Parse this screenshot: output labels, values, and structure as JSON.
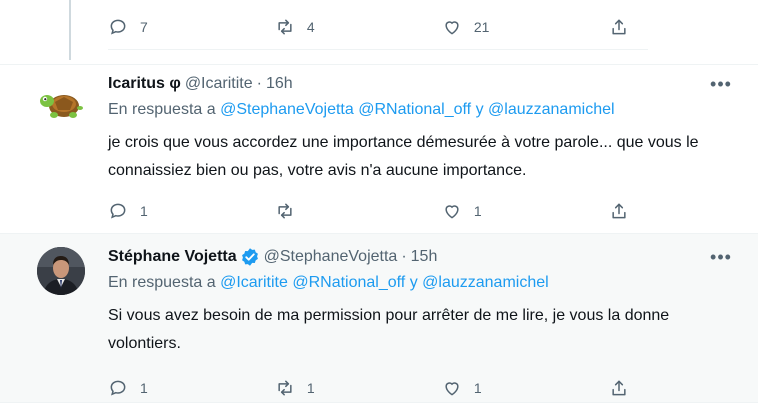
{
  "top_tweet": {
    "actions": {
      "reply_count": "7",
      "retweet_count": "4",
      "like_count": "21",
      "share_count": ""
    }
  },
  "tweets": [
    {
      "name": "Icaritus φ",
      "handle": "@Icaritite",
      "dot": "·",
      "time": "16h",
      "reply_prefix": "En respuesta a",
      "mentions": [
        "@StephaneVojetta",
        "@RNational_off",
        "@lauzzanamichel"
      ],
      "connector": "y",
      "text": "je crois que vous accordez une importance démesurée à votre parole... que vous le connaissiez bien ou pas, votre avis n'a aucune importance.",
      "actions": {
        "reply_count": "1",
        "retweet_count": "",
        "like_count": "1"
      },
      "avatar_icon": "turtle-avatar-icon"
    },
    {
      "name": "Stéphane Vojetta",
      "handle": "@StephaneVojetta",
      "dot": "·",
      "time": "15h",
      "reply_prefix": "En respuesta a",
      "mentions": [
        "@Icaritite",
        "@RNational_off",
        "@lauzzanamichel"
      ],
      "connector": "y",
      "text": "Si vous avez besoin de ma permission pour arrêter de me lire, je vous la donne volontiers.",
      "actions": {
        "reply_count": "1",
        "retweet_count": "1",
        "like_count": "1"
      },
      "verified": true,
      "avatar_icon": "profile-photo-avatar"
    }
  ],
  "more_label": "•••",
  "colors": {
    "accent": "#1d9bf0",
    "muted": "#536471",
    "text": "#0f1419"
  }
}
